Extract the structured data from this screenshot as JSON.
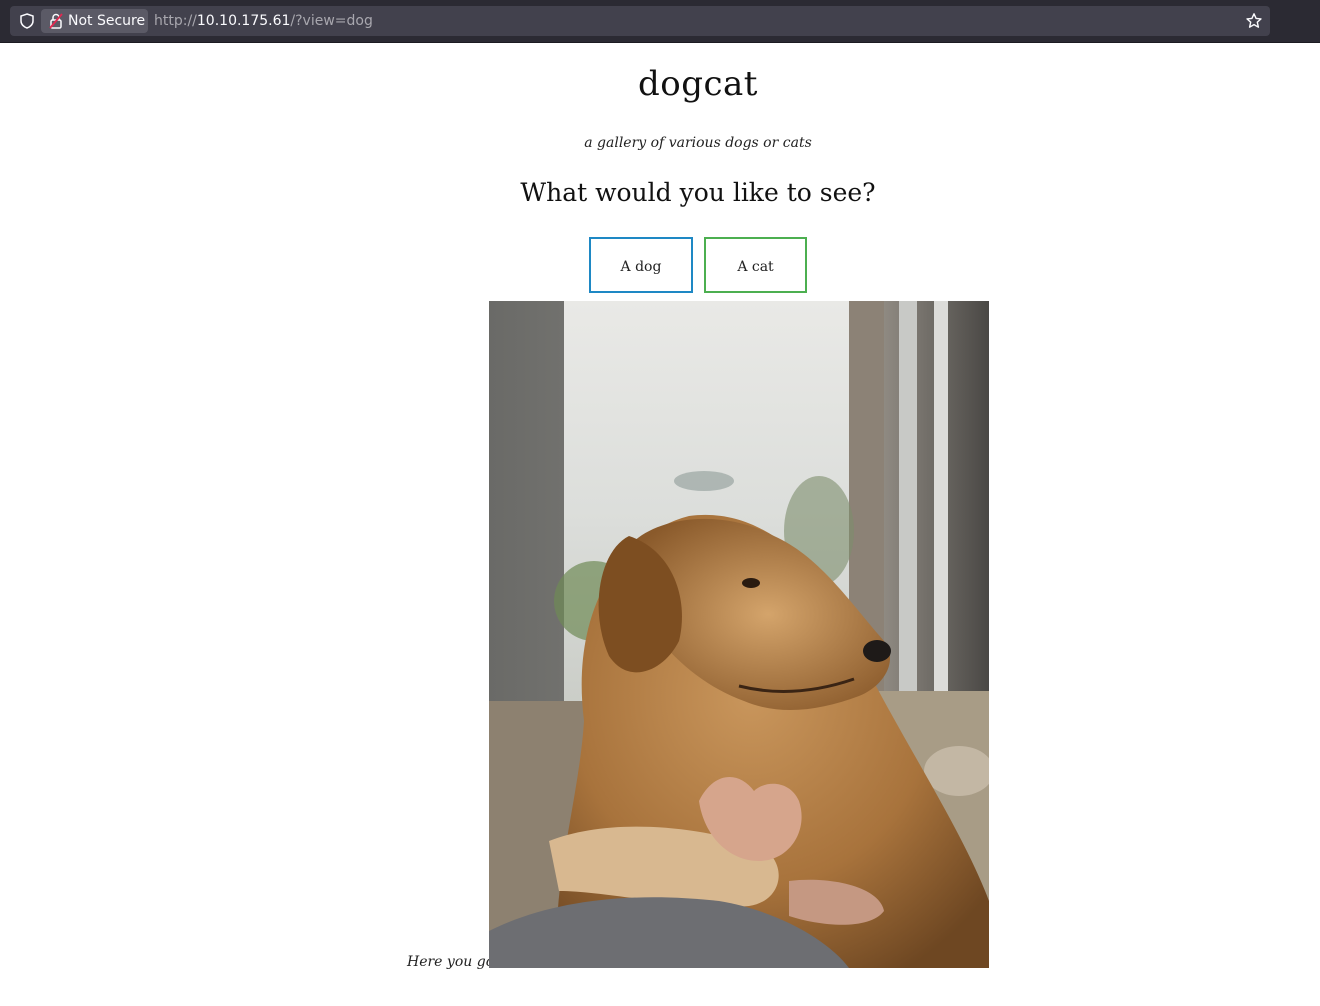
{
  "browser": {
    "security_label": "Not Secure",
    "url_scheme": "http://",
    "url_host": "10.10.175.61",
    "url_path": "/?view=dog"
  },
  "page": {
    "title": "dogcat",
    "subtitle": "a gallery of various dogs or cats",
    "question": "What would you like to see?",
    "buttons": {
      "dog": "A dog",
      "cat": "A cat"
    },
    "caption": "Here you go!",
    "colors": {
      "dog_border": "#1e88c4",
      "cat_border": "#4caf50"
    }
  }
}
